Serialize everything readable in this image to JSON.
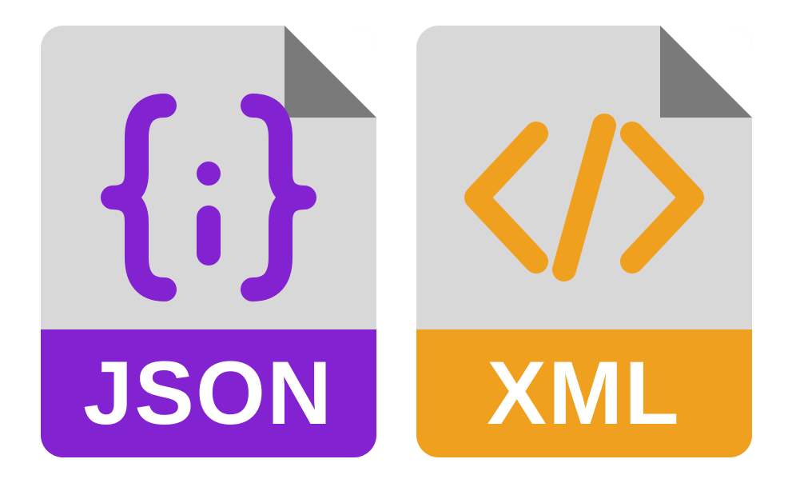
{
  "files": {
    "json": {
      "label": "JSON",
      "color": "#8322d0",
      "symbol": "code-braces"
    },
    "xml": {
      "label": "XML",
      "color": "#f0a01f",
      "symbol": "code-tags"
    }
  }
}
